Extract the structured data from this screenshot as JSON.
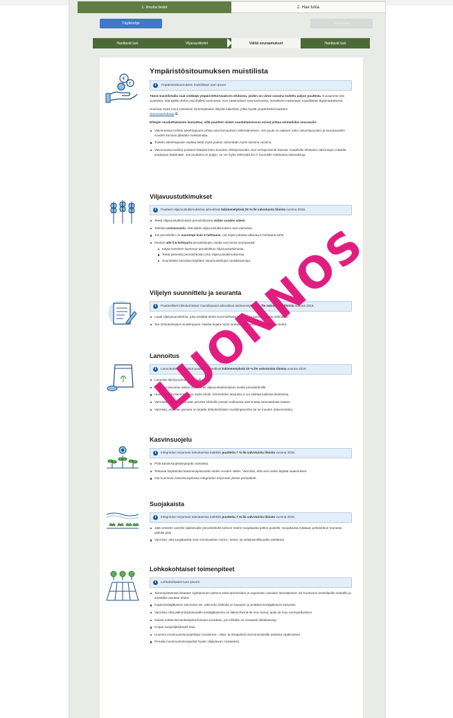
{
  "steps": [
    {
      "label": "1. Ilmoita tiedot"
    },
    {
      "label": "2. Hae tukia"
    }
  ],
  "buttons": {
    "fill": "Täyttöohje",
    "next": "Seuraava"
  },
  "breadcrumbs": [
    "Haettavat tuet",
    "Viljavuustiedot",
    "Välitä seuraamukset",
    "Haettavat tuet"
  ],
  "watermark": "LUONNOS",
  "sections": {
    "checklist": {
      "title": "Ympäristösitoumuksen muistilista",
      "info": "Ympäristösitoumuksen muistilistan tuen ipsum",
      "p1_bold": "Tämä muistilistalla saat vinkkejä ympäristökorvauksen ehdoista, joiden on viime vuosina todettu paljon puutteita.",
      "p1_rest": "Kuvaamme sen vuoksista, että kaikki ehdot ovat tilallesi tuonnossa. Kun vaatimukset ovat tuonnossa, lomakkeet maksetaan muistilistasi täysimääräisenä.",
      "p2": "Huomaa myös muut voitissiani toimenpiteiden liittyvät tukiehdot, jotka löydät ympäristökorvauksen",
      "p2_link": "sitoumusehdoista",
      "p3_bold": "Ehtojen noudattamiseen kannattaa, sillä puutteet niiden noudattamisessa voivat johtaa esimerkiksi seuraaviin:",
      "bullets": [
        "Valvonnassa todettu tukiehtopuute johtaa aina korvauksen vähentämiseen. Jos puute on vakava, koko valvontavuoden ja seuraavankin vuoden korvaus jätetään maksamatta.",
        "Todettu tukiehtopuute vaattaa tästä myös jaukus valvontaan myös tulevina vuosina.",
        "Valvonnassa todetut puutteet lisäävät koko Suomen virheprosenttia. Kun virheprosentti kasvaa, maatiloille tehtävien valvontojen määrää joudutaan lisäämään. Jos puutteita on paljon, se voi myös vähentää EU:n Suomelle maksamia tukimaksuja."
      ]
    },
    "soil": {
      "title": "Viljavuustutkimukset",
      "info_pre": "Puutteet viljavuustutkimuksissa aiheuttivat",
      "info_bold": "tukimenetyksiä 25 %:lle valvotuista tiloista",
      "info_post": "vuonna 2019.",
      "bullets": [
        {
          "pre": "Teetä viljavuustutkimukset peruslohkoista ",
          "bold": "viiden vuoden välein",
          "post": "."
        },
        {
          "pre": "Tarkista ",
          "bold": "voimassaolo",
          "post": ", että kaikki viljavuustutkimukset ovat voimassa."
        },
        {
          "pre": "Jos peruslohko on ",
          "bold": "suurempi kuin 5 hehtaaria",
          "post": ", ota näyte jokaista alkavaa 5 hehtaaria kohti."
        },
        {
          "pre": "Pienten ",
          "bold": "alle 0,5 hehtaarin",
          "post": " peruslohkojen osalta voit toimia seuraavasti:"
        }
      ],
      "sub": [
        "Käytä viereisen isomman peruslohkon viljavuustutkimusta.",
        "Teetä pienestä peruslohkosta oma viljavuustutkimuksensa.",
        "Suunnittele lannoitus käyttäen sitoumusehtojen taulukkoarvoja."
      ]
    },
    "planning": {
      "title": "Viljelyn suunnittelu ja seuranta",
      "info_pre": "Puutteelliset lohkokohtaiset muistiinpanot aiheuttivat tukimenetyksiä",
      "info_bold": "% :lle valvotuista tiloista",
      "info_post": "vuonna 2019.",
      "bullets": [
        "Laadi viljelysuunnitelma, joka sisältää tiedot suunnitellusta kasvista ja lannoituksesta lohkoittain.",
        "Tee lohkokohtaiset muistiinpanot. Muista kirjata myös tuotanto-/lannoituksesta edellyttyt tiedot."
      ]
    },
    "fertilizing": {
      "title": "Lannoitus",
      "info_pre": "Lannoituksessa todetut puutteet aiheuttivat",
      "info_bold": "tukimenetyksiä 20 %:lle valvotuista tiloista",
      "info_post": "vuonna 2019.",
      "bullets": [
        "Lannoita viljelysuunnitelman mukaisesti.",
        "Kohdista lannoitus sadon mukaisesti viljavuustutkimuksen avulla peruslohkoille.",
        "Huomioi fosforilannoituksen myös ehdot. Esimerkiksi tasausta ei voi aloittaa kaikissa tilanteissa.",
        "Varmista, että tukipinta-alan peruste lohkoille jossain vaiheessa aiemmasta satovasdosta sataon.",
        "Varmista, että tilan perusta on kirjattu lohkokohtaisiin muistiinpanoihin tai ne muuten dokumentoitu."
      ]
    },
    "protection": {
      "title": "Kasvinsuojelu",
      "info_pre": "Integroidun torjunnan toteuttaessa todettiin",
      "info_bold": "puutteita 7 %:lla valvotuista tiloista",
      "info_post": "vuonna 2019.",
      "bullets": [
        "Pidä kasvinsuojelukirjanpito voimassa.",
        "Testauta käyttämäsi kasvinsuojeluruisku viiden vuoden välein. Varmista, että uusi ruisku täyttää vaatimukset.",
        "Ota huomioon kasvinsuojelussa integroidun torjunnan yleiset periaatteet."
      ]
    },
    "buffer": {
      "title": "Suojakaista",
      "info_pre": "Integroidun torjunnan toteuttaessa todettiin",
      "info_bold": "puutteita 7 %:lla valvotuista tiloista",
      "info_post": "vuonna 2019.",
      "bullets": [
        "Jätä vesistön varrelle sijaitsevalle peruslohkolle kolmen metrin suojakaista pellon puolelle. Suojakaista mitataan peltolohkon reunasta pellolle päin.",
        "Varmista, että suojakaistat ovat monivuotisen nurmi-, heinä- tai niittykasvillisuuden peittämiä."
      ]
    },
    "parcel": {
      "title": "Lohkokohtaiset toimenpiteet",
      "info": "Lohkokohtaiset tuen ipsumt",
      "bullets": [
        "Tarraospisteessä listataan sijoittaminen peltoon sekä tarrimisiden ja organisten aineiden lisenäämisen ois huomioon lentotilaville reidarille ja aineksille asetetut ehdot.",
        "Käytä kerääjäkasvin siementä niin, että koko lohkolla on tasainen ja peittävä kerääjäkasvin kasvusto.",
        "Varmista, että palkomlöykasvaville kerääjäkasvina on italiannheinä tai muu heinä, apila tai muu nurmipalkokasvi.",
        "Muista erittää lannanlevityskorfomuint vuosittain, jos lohkolla on runsaasti rikkakasveja.",
        "Korjaa suojaviljelykasvit sato.",
        "Huomioi monimuotoisuuspeltojen (maisema-, riista- ja riistapellot) siemenseoksille asetetut vaatimukset.",
        "Perusta monimuotoisuuspellot hyvän viljelytavan mukaisesti."
      ]
    }
  },
  "colors": {
    "accent": "#3e78c7",
    "nav_green": "#4c6a36",
    "watermark": "#e0137a",
    "info_bg": "#e4eef9"
  }
}
